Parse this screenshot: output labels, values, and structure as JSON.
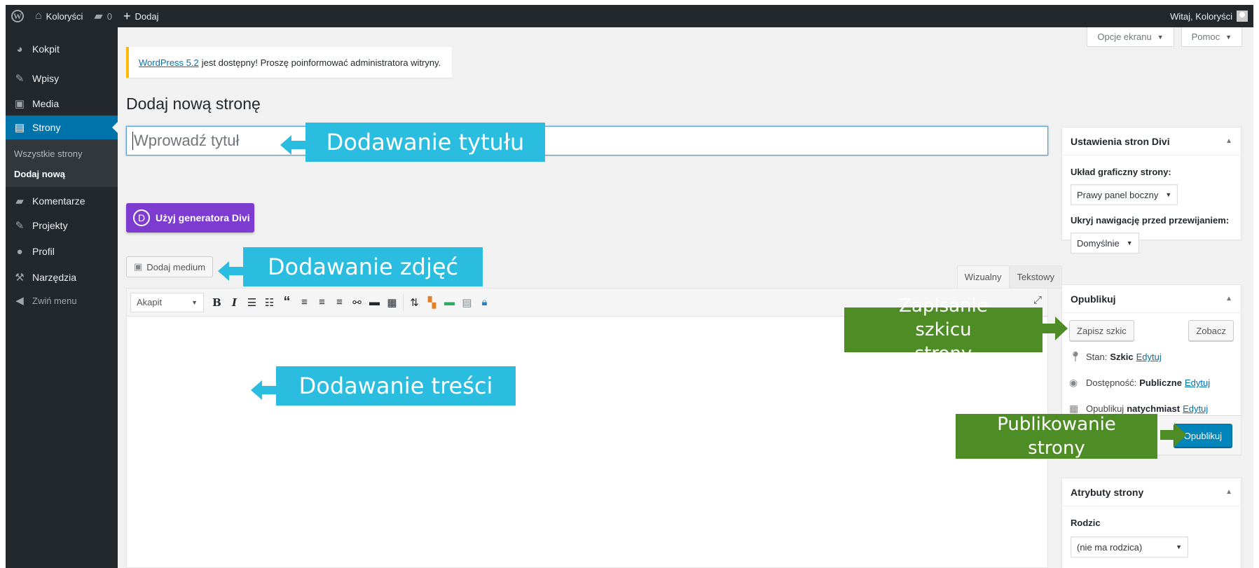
{
  "admin_bar": {
    "site_name": "Koloryści",
    "comments_count": "0",
    "add_new": "Dodaj",
    "greeting": "Witaj, Koloryści"
  },
  "sidebar": {
    "items": [
      {
        "label": "Kokpit",
        "icon": "dashboard-icon"
      },
      {
        "label": "Wpisy",
        "icon": "pin-icon"
      },
      {
        "label": "Media",
        "icon": "media-icon"
      },
      {
        "label": "Strony",
        "icon": "pages-icon"
      },
      {
        "label": "Komentarze",
        "icon": "comment-icon"
      },
      {
        "label": "Projekty",
        "icon": "pin-icon"
      },
      {
        "label": "Profil",
        "icon": "user-icon"
      },
      {
        "label": "Narzędzia",
        "icon": "wrench-icon"
      }
    ],
    "submenu": [
      "Wszystkie strony",
      "Dodaj nową"
    ],
    "collapse": "Zwiń menu"
  },
  "screen_options": "Opcje ekranu",
  "help": "Pomoc",
  "notice": {
    "link": "WordPress 5.2",
    "text": "jest dostępny! Proszę poinformować administratora witryny."
  },
  "page_title": "Dodaj nową stronę",
  "title_placeholder": "Wprowadź tytuł",
  "divi_button": "Użyj generatora Divi",
  "divi_letter": "D",
  "add_media": "Dodaj medium",
  "editor_tabs": [
    "Wizualny",
    "Tekstowy"
  ],
  "format_select": "Akapit",
  "divi_settings": {
    "title": "Ustawienia stron Divi",
    "layout_label": "Układ graficzny strony:",
    "layout_value": "Prawy panel boczny",
    "nav_label": "Ukryj nawigację przed przewijaniem:",
    "nav_value": "Domyślnie"
  },
  "publish": {
    "title": "Opublikuj",
    "save_draft": "Zapisz szkic",
    "preview": "Zobacz",
    "status_label": "Stan:",
    "status_value": "Szkic",
    "visibility_label": "Dostępność:",
    "visibility_value": "Publiczne",
    "schedule_label": "Opublikuj",
    "schedule_value": "natychmiast",
    "edit": "Edytuj",
    "publish_button": "Opublikuj"
  },
  "attributes": {
    "title": "Atrybuty strony",
    "parent_label": "Rodzic",
    "parent_value": "(nie ma rodzica)"
  },
  "annotations": {
    "title": "Dodawanie tytułu",
    "images": "Dodawanie zdjęć",
    "content": "Dodawanie treści",
    "draft": "Zapisanie szkicu strony",
    "publish": "Publikowanie strony"
  },
  "colors": {
    "admin_bar": "#23282d",
    "active_menu": "#0073aa",
    "divi_purple": "#7e3bd0",
    "primary_button": "#0085ba",
    "callout_cyan": "#2bbde0",
    "callout_green": "#4e8c25"
  }
}
